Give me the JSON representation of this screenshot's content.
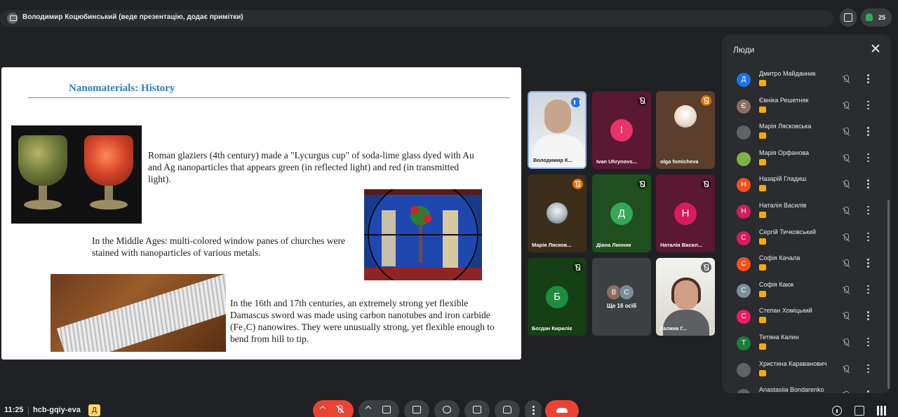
{
  "header": {
    "presenter_label": "Володимир Коцюбинський (веде презентацію, додає примітки)",
    "participant_count": "25"
  },
  "slide": {
    "title": "Nanomaterials: History",
    "paragraph1": "Roman glaziers (4th century) made a \"Lycurgus cup\" of soda-lime glass dyed with Au and Ag nanoparticles that appears green (in reflected light) and red (in transmitted light).",
    "paragraph2": "In the Middle Ages: multi-colored window panes of churches were stained with nanoparticles of various metals.",
    "paragraph3": "In the 16th and 17th centuries, an extremely strong yet flexible Damascus sword was made using carbon nanotubes and iron carbide (Fe₃C) nanowires. They were unusually strong, yet flexible enough to bend from hill to tip."
  },
  "tiles": [
    {
      "name": "Володимир К...",
      "initial": ""
    },
    {
      "name": "Ivan Uhrynovs...",
      "initial": "I",
      "color": "#e8336b"
    },
    {
      "name": "olga fomicheva",
      "initial": ""
    },
    {
      "name": "Марія Лясков...",
      "initial": ""
    },
    {
      "name": "Діана Линник",
      "initial": "Д",
      "color": "#34a853"
    },
    {
      "name": "Наталія Васил...",
      "initial": "Н",
      "color": "#d81b60"
    },
    {
      "name": "Богдан Кириліє",
      "initial": "Б",
      "color": "#1e8e3e"
    },
    {
      "name": "Ще 16 осіб",
      "initial": ""
    },
    {
      "name": "Галина Г...",
      "initial": ""
    }
  ],
  "more_tile": {
    "initials": [
      "В",
      "С"
    ],
    "colors": [
      "#8d6e63",
      "#78909c"
    ]
  },
  "panel": {
    "title": "Люди",
    "people": [
      {
        "name": "Дмитро Майданник",
        "initial": "Д",
        "color": "#1a73e8"
      },
      {
        "name": "Євніка Решетняк",
        "initial": "Є",
        "color": "#8d6e63"
      },
      {
        "name": "Марія Лясковська",
        "initial": "",
        "color": "#5f6368"
      },
      {
        "name": "Марія Орфанова",
        "initial": "",
        "color": "#7cb342"
      },
      {
        "name": "Назарій Гладиш",
        "initial": "Н",
        "color": "#f4511e"
      },
      {
        "name": "Наталія Василів",
        "initial": "Н",
        "color": "#d81b60"
      },
      {
        "name": "Сергій Тичковський",
        "initial": "С",
        "color": "#d81b60"
      },
      {
        "name": "Софія Качала",
        "initial": "С",
        "color": "#f4511e"
      },
      {
        "name": "Софія Каюк",
        "initial": "С",
        "color": "#78909c"
      },
      {
        "name": "Степан Хоміцький",
        "initial": "С",
        "color": "#e91e63"
      },
      {
        "name": "Тетяна Калин",
        "initial": "Т",
        "color": "#188038"
      },
      {
        "name": "Христина Караванович",
        "initial": "",
        "color": "#5f6368"
      },
      {
        "name": "Anastasiia Bondarenko",
        "initial": "",
        "color": "#5f6368"
      }
    ]
  },
  "bottom": {
    "time": "11:25",
    "meeting_code": "hcb-gqiy-eva",
    "code_badge": "Д"
  }
}
